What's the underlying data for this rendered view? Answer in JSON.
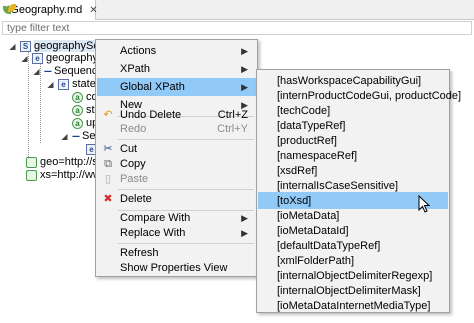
{
  "tab": {
    "title": "*Geography.md",
    "close": "✕"
  },
  "filter": {
    "placeholder": "type filter text"
  },
  "tree": {
    "schema": {
      "badge": "S",
      "label": "geographySchen"
    },
    "geography": {
      "badge": "e",
      "label": "geography"
    },
    "sequence1": {
      "label": "Sequence",
      "glyph": "---"
    },
    "state": {
      "badge": "e",
      "label": "state"
    },
    "attr1": {
      "badge": "a",
      "label": "co"
    },
    "attr2": {
      "badge": "a",
      "label": "sta"
    },
    "attr3": {
      "badge": "a",
      "label": "up"
    },
    "sequence2": {
      "label": "Se",
      "glyph": "---"
    },
    "elem_e": {
      "badge": "e"
    },
    "ns_geo": {
      "label": "geo=http://s"
    },
    "ns_xs": {
      "label": "xs=http://ww"
    }
  },
  "context_menu": {
    "items": [
      {
        "label": "Actions",
        "submenu": true
      },
      {
        "label": "XPath",
        "submenu": true
      },
      {
        "label": "Global XPath",
        "submenu": true,
        "highlighted": true
      },
      {
        "label": "New",
        "submenu": true
      },
      {
        "label": "Undo Delete",
        "accel": "Ctrl+Z",
        "icon": "undo-icon"
      },
      {
        "label": "Redo",
        "accel": "Ctrl+Y",
        "disabled": true
      },
      {
        "label": "Cut",
        "icon": "cut-icon"
      },
      {
        "label": "Copy"
      },
      {
        "label": "Paste",
        "disabled": true
      },
      {
        "label": "Delete",
        "icon": "delete-icon"
      },
      {
        "label": "Compare With",
        "submenu": true
      },
      {
        "label": "Replace With",
        "submenu": true
      },
      {
        "label": "Refresh"
      },
      {
        "label": "Show Properties View"
      }
    ]
  },
  "xpath_submenu": {
    "items": [
      "[hasWorkspaceCapabilityGui]",
      "[internProductCodeGui, productCode]",
      "[techCode]",
      "[dataTypeRef]",
      "[productRef]",
      "[namespaceRef]",
      "[xsdRef]",
      "[internalIsCaseSensitive]",
      "[toXsd]",
      "[ioMetaData]",
      "[ioMetaDataId]",
      "[defaultDataTypeRef]",
      "[xmlFolderPath]",
      "[internalObjectDelimiterRegexp]",
      "[internalObjectDelimiterMask]",
      "[ioMetaDataInternetMediaType]"
    ],
    "highlighted_index": 8
  },
  "colors": {
    "menu_highlight": "#91c9f7",
    "menu_bg": "#f2f2f2",
    "disabled_text": "#8c8c8c"
  }
}
